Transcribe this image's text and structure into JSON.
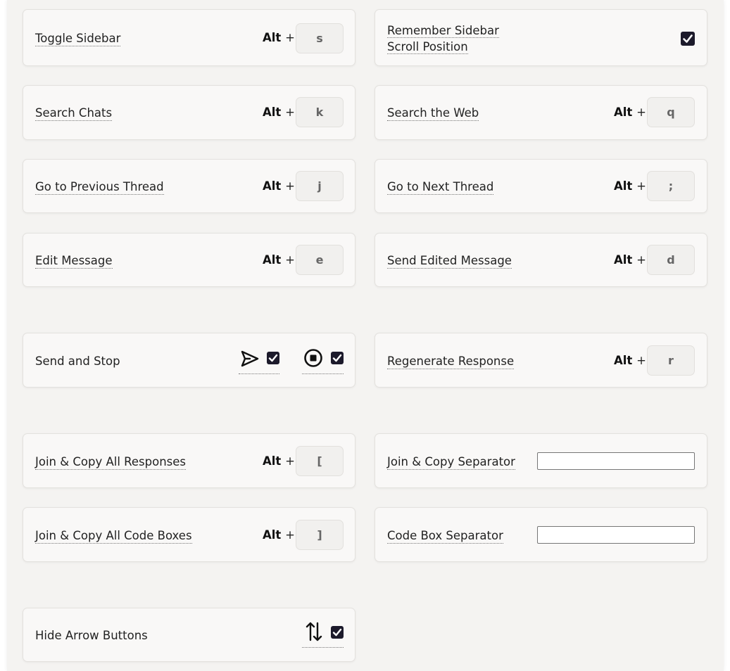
{
  "alt_label": "Alt",
  "plus": "+",
  "cards": {
    "toggle_sidebar": {
      "label": "Toggle Sidebar",
      "key": "s"
    },
    "remember_scroll": {
      "label_line1": "Remember Sidebar",
      "label_line2": "Scroll Position",
      "checked": true
    },
    "search_chats": {
      "label": "Search Chats",
      "key": "k"
    },
    "search_web": {
      "label": "Search the Web",
      "key": "q"
    },
    "prev_thread": {
      "label": "Go to Previous Thread",
      "key": "j"
    },
    "next_thread": {
      "label": "Go to Next Thread",
      "key": ";"
    },
    "edit_message": {
      "label": "Edit Message",
      "key": "e"
    },
    "send_edited": {
      "label": "Send Edited Message",
      "key": "d"
    },
    "send_stop": {
      "label": "Send and Stop",
      "send_checked": true,
      "stop_checked": true
    },
    "regenerate": {
      "label": "Regenerate Response",
      "key": "r"
    },
    "join_copy_responses": {
      "label": "Join & Copy All Responses",
      "key": "["
    },
    "join_copy_separator": {
      "label": "Join & Copy Separator",
      "value": ""
    },
    "join_copy_code": {
      "label": "Join & Copy All Code Boxes",
      "key": "]"
    },
    "code_separator": {
      "label": "Code Box Separator",
      "value": ""
    },
    "hide_arrows": {
      "label": "Hide Arrow Buttons",
      "checked": true
    }
  },
  "icons": {
    "send": "send-icon",
    "stop": "stop-icon",
    "arrows": "up-down-arrows-icon",
    "check": "checkmark-icon"
  },
  "colors": {
    "panel_bg": "#f4f3f1",
    "card_bg": "#f9f8f7",
    "checkbox": "#1c1a2b"
  }
}
